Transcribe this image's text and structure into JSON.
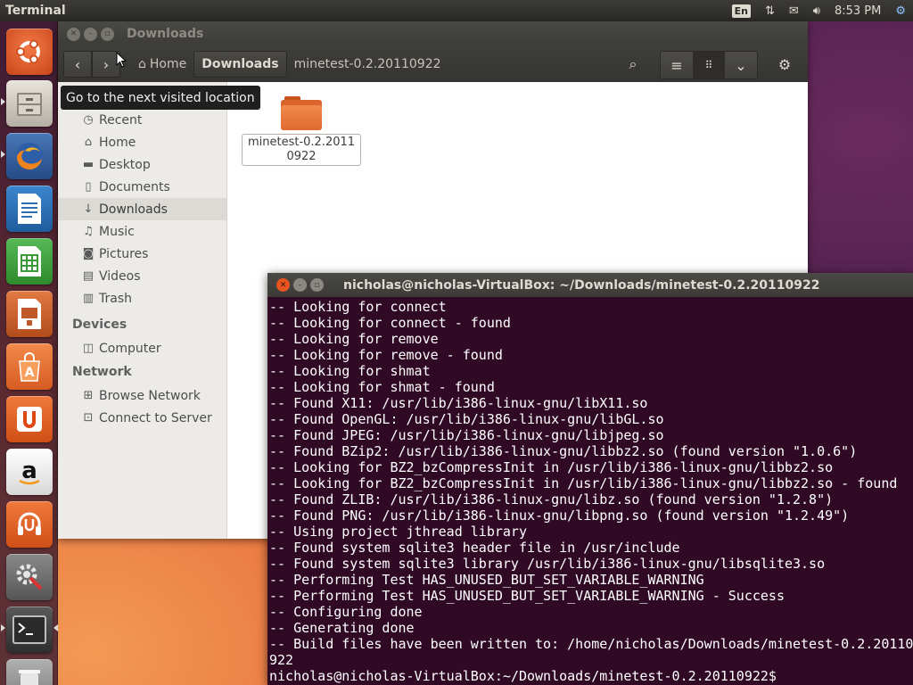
{
  "top_panel": {
    "app_title": "Terminal",
    "keyboard_layout": "En",
    "clock": "8:53 PM"
  },
  "launcher": {
    "items": [
      {
        "name": "dash-home",
        "icon": "ubuntu-logo-icon",
        "color": "#e95420"
      },
      {
        "name": "files",
        "icon": "file-cabinet-icon",
        "color": "#b8b2a8"
      },
      {
        "name": "firefox",
        "icon": "firefox-icon",
        "color": "#e8701e"
      },
      {
        "name": "writer",
        "icon": "libreoffice-writer-icon",
        "color": "#2d6fb3"
      },
      {
        "name": "calc",
        "icon": "libreoffice-calc-icon",
        "color": "#3a9a3a"
      },
      {
        "name": "impress",
        "icon": "libreoffice-impress-icon",
        "color": "#c0592a"
      },
      {
        "name": "software-center",
        "icon": "shopping-bag-icon",
        "color": "#e8672a"
      },
      {
        "name": "ubuntu-one",
        "icon": "ubuntu-one-icon",
        "color": "#e8672a"
      },
      {
        "name": "amazon",
        "icon": "amazon-icon",
        "color": "#f2f2f2"
      },
      {
        "name": "ubuntu-one-music",
        "icon": "headphones-icon",
        "color": "#e8672a"
      },
      {
        "name": "system-settings",
        "icon": "settings-icon",
        "color": "#7a7a7a"
      },
      {
        "name": "terminal",
        "icon": "terminal-icon",
        "color": "#3a3a3a"
      },
      {
        "name": "trash",
        "icon": "trash-icon",
        "color": "#8a8a8a"
      }
    ]
  },
  "files": {
    "window_title": "Downloads",
    "breadcrumbs": {
      "home": "Home",
      "current": "Downloads",
      "next": "minetest-0.2.20110922"
    },
    "tooltip": "Go to the next visited location",
    "sidebar": {
      "places": [
        {
          "label": "Recent",
          "icon": "clock-icon",
          "glyph": "◷"
        },
        {
          "label": "Home",
          "icon": "home-icon",
          "glyph": "⌂"
        },
        {
          "label": "Desktop",
          "icon": "folder-icon",
          "glyph": "▬"
        },
        {
          "label": "Documents",
          "icon": "document-icon",
          "glyph": "▯"
        },
        {
          "label": "Downloads",
          "icon": "download-icon",
          "glyph": "↓"
        },
        {
          "label": "Music",
          "icon": "music-icon",
          "glyph": "♫"
        },
        {
          "label": "Pictures",
          "icon": "camera-icon",
          "glyph": "◙"
        },
        {
          "label": "Videos",
          "icon": "film-icon",
          "glyph": "▤"
        },
        {
          "label": "Trash",
          "icon": "trash-icon",
          "glyph": "▥"
        }
      ],
      "devices_header": "Devices",
      "devices": [
        {
          "label": "Computer",
          "icon": "drive-icon",
          "glyph": "◫"
        }
      ],
      "network_header": "Network",
      "network": [
        {
          "label": "Browse Network",
          "icon": "network-icon",
          "glyph": "⊞"
        },
        {
          "label": "Connect to Server",
          "icon": "server-icon",
          "glyph": "⊡"
        }
      ]
    },
    "content": {
      "folder_name": "minetest-0.2.20110922"
    }
  },
  "terminal": {
    "window_title": "nicholas@nicholas-VirtualBox: ~/Downloads/minetest-0.2.20110922",
    "lines": [
      "-- Looking for connect",
      "-- Looking for connect - found",
      "-- Looking for remove",
      "-- Looking for remove - found",
      "-- Looking for shmat",
      "-- Looking for shmat - found",
      "-- Found X11: /usr/lib/i386-linux-gnu/libX11.so",
      "-- Found OpenGL: /usr/lib/i386-linux-gnu/libGL.so",
      "-- Found JPEG: /usr/lib/i386-linux-gnu/libjpeg.so",
      "-- Found BZip2: /usr/lib/i386-linux-gnu/libbz2.so (found version \"1.0.6\")",
      "-- Looking for BZ2_bzCompressInit in /usr/lib/i386-linux-gnu/libbz2.so",
      "-- Looking for BZ2_bzCompressInit in /usr/lib/i386-linux-gnu/libbz2.so - found",
      "-- Found ZLIB: /usr/lib/i386-linux-gnu/libz.so (found version \"1.2.8\")",
      "-- Found PNG: /usr/lib/i386-linux-gnu/libpng.so (found version \"1.2.49\")",
      "-- Using project jthread library",
      "-- Found system sqlite3 header file in /usr/include",
      "-- Found system sqlite3 library /usr/lib/i386-linux-gnu/libsqlite3.so",
      "-- Performing Test HAS_UNUSED_BUT_SET_VARIABLE_WARNING",
      "-- Performing Test HAS_UNUSED_BUT_SET_VARIABLE_WARNING - Success",
      "-- Configuring done",
      "-- Generating done",
      "-- Build files have been written to: /home/nicholas/Downloads/minetest-0.2.20110",
      "922",
      "nicholas@nicholas-VirtualBox:~/Downloads/minetest-0.2.20110922$"
    ]
  }
}
